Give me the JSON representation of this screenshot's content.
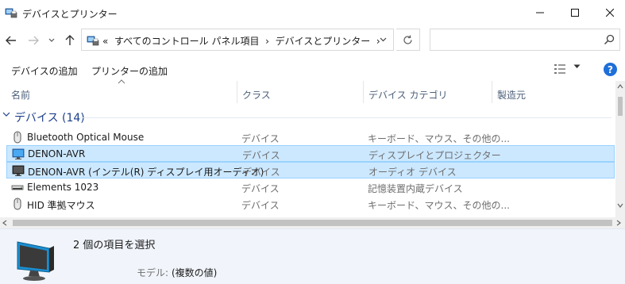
{
  "window": {
    "title": "デバイスとプリンター"
  },
  "addressbar": {
    "overflow": "«",
    "path": [
      "すべてのコントロール パネル項目",
      "デバイスとプリンター"
    ],
    "separator": "›"
  },
  "search": {
    "placeholder": ""
  },
  "commands": {
    "add_device": "デバイスの追加",
    "add_printer": "プリンターの追加"
  },
  "columns": {
    "name": "名前",
    "class": "クラス",
    "category": "デバイス カテゴリ",
    "manufacturer": "製造元"
  },
  "group": {
    "title": "デバイス (14)"
  },
  "rows": [
    {
      "name": "Bluetooth Optical Mouse",
      "class": "デバイス",
      "category": "キーボード、マウス、その他の...",
      "icon": "mouse-icon",
      "selected": false
    },
    {
      "name": "DENON-AVR",
      "class": "デバイス",
      "category": "ディスプレイとプロジェクター",
      "icon": "monitor-icon",
      "selected": true
    },
    {
      "name": "DENON-AVR (インテル(R) ディスプレイ用オーディオ)",
      "class": "デバイス",
      "category": "オーディオ デバイス",
      "icon": "monitor-dark-icon",
      "selected": true
    },
    {
      "name": "Elements 1023",
      "class": "デバイス",
      "category": "記憶装置内蔵デバイス",
      "icon": "drive-icon",
      "selected": false
    },
    {
      "name": "HID 準拠マウス",
      "class": "デバイス",
      "category": "キーボード、マウス、その他の...",
      "icon": "mouse-icon",
      "selected": false
    }
  ],
  "details": {
    "title": "2 個の項目を選択",
    "model_label": "モデル:",
    "model_value": "(複数の値)"
  },
  "colors": {
    "selection_bg": "#cce8ff",
    "selection_border": "#99d1ff",
    "group_title": "#1e3f8a",
    "details_bg": "#f1f5fb",
    "help_blue": "#1e6fd9"
  }
}
